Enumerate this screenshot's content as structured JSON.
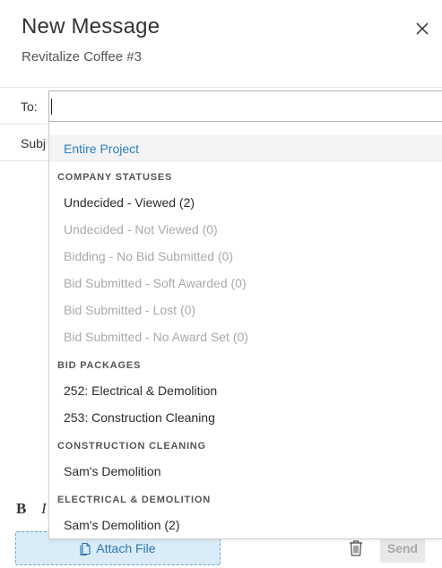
{
  "header": {
    "title": "New Message",
    "subtitle": "Revitalize Coffee #3"
  },
  "form": {
    "to_label": "To:",
    "to_value": "",
    "subject_label_visible": "Subj"
  },
  "dropdown": {
    "entire_project": "Entire Project",
    "groups": [
      {
        "label": "COMPANY STATUSES",
        "items": [
          {
            "label": "Undecided - Viewed (2)",
            "enabled": true
          },
          {
            "label": "Undecided - Not Viewed (0)",
            "enabled": false
          },
          {
            "label": "Bidding - No Bid Submitted (0)",
            "enabled": false
          },
          {
            "label": "Bid Submitted - Soft Awarded (0)",
            "enabled": false
          },
          {
            "label": "Bid Submitted - Lost (0)",
            "enabled": false
          },
          {
            "label": "Bid Submitted - No Award Set (0)",
            "enabled": false
          }
        ]
      },
      {
        "label": "BID PACKAGES",
        "items": [
          {
            "label": "252: Electrical & Demolition",
            "enabled": true
          },
          {
            "label": "253: Construction Cleaning",
            "enabled": true
          }
        ]
      },
      {
        "label": "CONSTRUCTION CLEANING",
        "items": [
          {
            "label": "Sam's Demolition",
            "enabled": true
          }
        ]
      },
      {
        "label": "ELECTRICAL & DEMOLITION",
        "items": [
          {
            "label": "Sam's Demolition (2)",
            "enabled": true
          }
        ]
      }
    ]
  },
  "toolbar": {
    "bold_label": "B",
    "italic_label": "I"
  },
  "footer": {
    "attach_label": "Attach File",
    "send_label": "Send"
  },
  "colors": {
    "accent": "#2a80c4",
    "attach_bg": "#d9ecf7",
    "disabled_text": "#a9a9a9"
  }
}
